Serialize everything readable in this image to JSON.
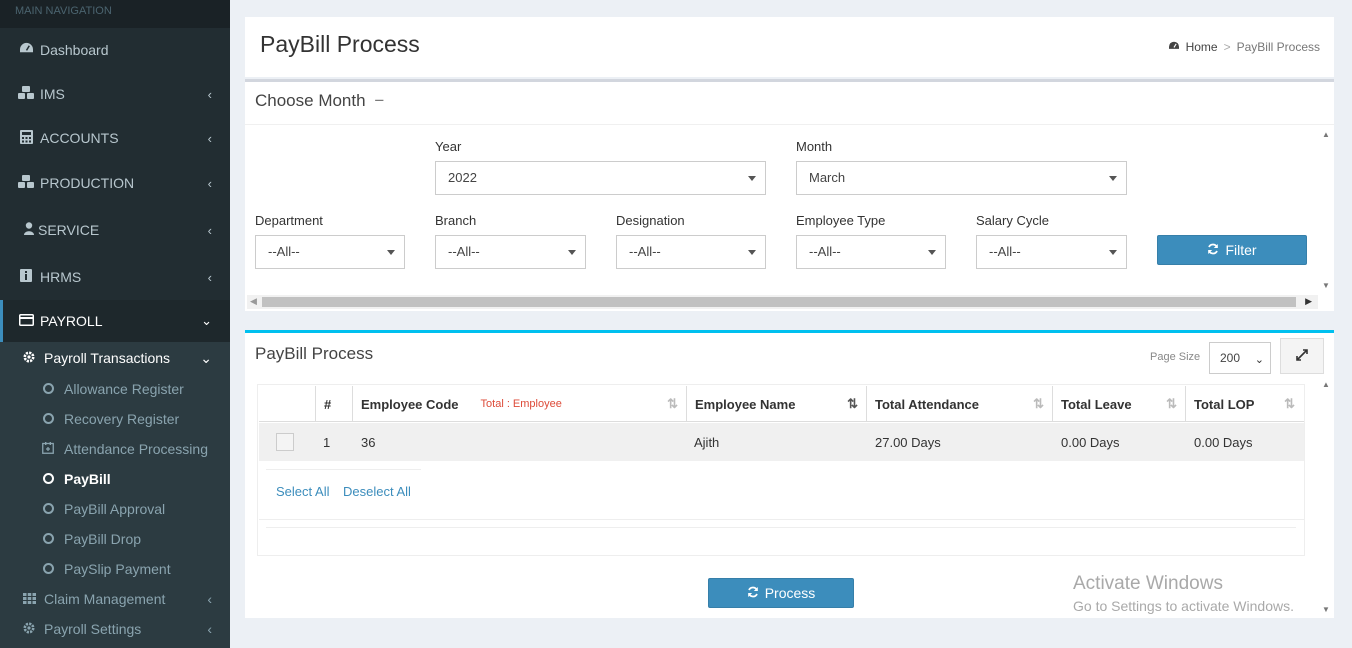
{
  "sidebar": {
    "header": "MAIN NAVIGATION",
    "items": [
      {
        "label": "Dashboard"
      },
      {
        "label": "IMS"
      },
      {
        "label": "ACCOUNTS"
      },
      {
        "label": "PRODUCTION"
      },
      {
        "label": "SERVICE"
      },
      {
        "label": "HRMS"
      },
      {
        "label": "PAYROLL"
      }
    ],
    "payroll_transactions": "Payroll Transactions",
    "sub_items": [
      "Allowance Register",
      "Recovery Register",
      "Attendance Processing",
      "PayBill",
      "PayBill Approval",
      "PayBill Drop",
      "PaySlip Payment"
    ],
    "claim_management": "Claim Management",
    "payroll_settings": "Payroll Settings"
  },
  "page": {
    "title": "PayBill Process"
  },
  "breadcrumb": {
    "home": "Home",
    "sep": ">",
    "current": "PayBill Process"
  },
  "filter_box": {
    "title": "Choose Month",
    "collapse": "−",
    "year_label": "Year",
    "year_value": "2022",
    "month_label": "Month",
    "month_value": "March",
    "department_label": "Department",
    "department_value": "--All--",
    "branch_label": "Branch",
    "branch_value": "--All--",
    "designation_label": "Designation",
    "designation_value": "--All--",
    "emptype_label": "Employee Type",
    "emptype_value": "--All--",
    "salary_label": "Salary Cycle",
    "salary_value": "--All--",
    "filter_button": "Filter"
  },
  "table_box": {
    "title": "PayBill Process",
    "page_size_label": "Page Size",
    "page_size_value": "200",
    "columns": [
      "#",
      "Employee Code",
      "Employee Name",
      "Total Attendance",
      "Total Leave",
      "Total LOP"
    ],
    "total_note": "Total : Employee",
    "rows": [
      {
        "num": "1",
        "code": "36",
        "name": "Ajith",
        "attendance": "27.00 Days",
        "leave": "0.00 Days",
        "lop": "0.00 Days"
      }
    ],
    "select_all": "Select All",
    "deselect_all": "Deselect All",
    "process_button": "Process"
  },
  "watermark": {
    "line1": "Activate Windows",
    "line2": "Go to Settings to activate Windows."
  },
  "colors": {
    "sidebar": "#222d32",
    "accent": "#3c8dbc",
    "page_bg": "#ecf0f5",
    "total_note": "#dd4b39"
  }
}
